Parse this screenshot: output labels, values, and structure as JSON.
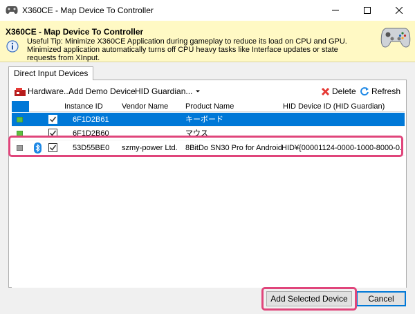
{
  "window": {
    "title": "X360CE - Map Device To Controller"
  },
  "header": {
    "title": "X360CE - Map Device To Controller",
    "tip_line1": "Useful Tip: Minimize X360CE Application during gameplay to reduce its load on CPU and GPU.",
    "tip_line2": "Minimized application automatically turns off CPU heavy tasks like Interface updates or state",
    "tip_line3": "requests from XInput."
  },
  "tabs": [
    {
      "label": "Direct Input Devices"
    }
  ],
  "toolbar": {
    "hardware_label": "Hardware...",
    "add_demo_label": "Add Demo Device",
    "hid_guardian_label": "HID Guardian...",
    "delete_label": "Delete",
    "refresh_label": "Refresh"
  },
  "grid": {
    "columns": [
      "Instance ID",
      "Vendor Name",
      "Product Name",
      "HID Device ID (HID Guardian)"
    ],
    "rows": [
      {
        "instance_id": "6F1D2B61",
        "vendor": "",
        "product": "キーボード",
        "hid": "",
        "bluetooth": false,
        "checked": true,
        "selected": true
      },
      {
        "instance_id": "6F1D2B60",
        "vendor": "",
        "product": "マウス",
        "hid": "",
        "bluetooth": false,
        "checked": true,
        "selected": false
      },
      {
        "instance_id": "53D55BE0",
        "vendor": "szmy-power Ltd.",
        "product": "8BitDo SN30 Pro for Android",
        "hid": "HID¥{00001124-0000-1000-8000-0...",
        "bluetooth": true,
        "checked": true,
        "selected": false
      }
    ]
  },
  "buttons": {
    "add_selected_label": "Add Selected Device",
    "cancel_label": "Cancel"
  },
  "colors": {
    "selection": "#0078d7",
    "header_bg": "#fff9c4",
    "highlight": "#e0457b"
  }
}
